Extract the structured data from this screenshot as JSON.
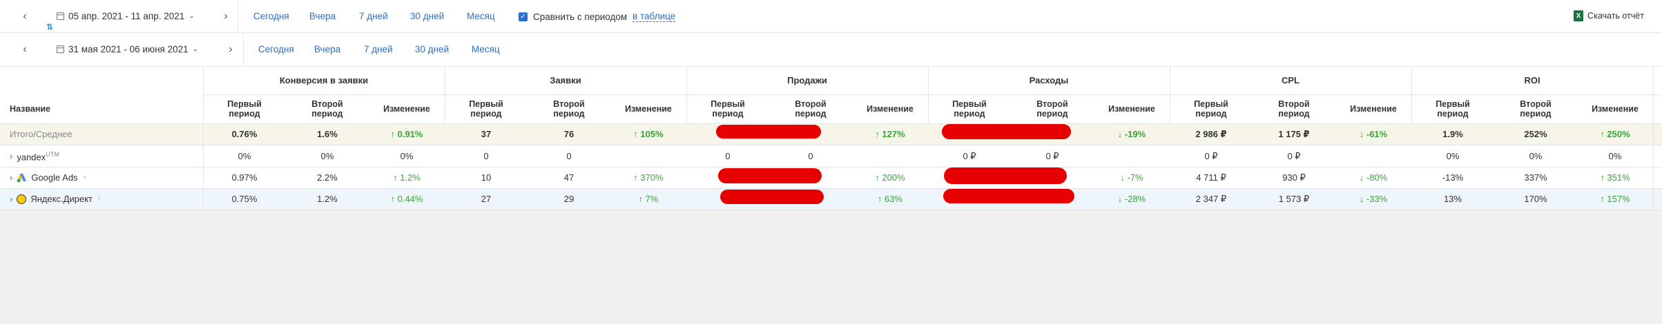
{
  "toolbar1": {
    "date_range": "05 апр. 2021 - 11 апр. 2021",
    "quick": [
      "Сегодня",
      "Вчера",
      "7 дней",
      "30 дней",
      "Месяц"
    ],
    "compare_label": "Сравнить с периодом",
    "compare_link": "в таблице",
    "compare_checked": true,
    "download": "Скачать отчёт"
  },
  "toolbar2": {
    "date_range": "31 мая 2021 - 06 июня 2021",
    "quick": [
      "Сегодня",
      "Вчера",
      "7 дней",
      "30 дней",
      "Месяц"
    ]
  },
  "table": {
    "name_header": "Название",
    "groups": [
      "Конверсия в заявки",
      "Заявки",
      "Продажи",
      "Расходы",
      "CPL",
      "ROI"
    ],
    "sub_headers": [
      "Первый период",
      "Второй период",
      "Изменение"
    ],
    "rows": [
      {
        "name": "Итого/Среднее",
        "kind": "total",
        "values": [
          "0.76%",
          "1.6%",
          "↑ 0.91%",
          "37",
          "76",
          "↑ 105%",
          "",
          "",
          "↑ 127%",
          "",
          "",
          "↓ -19%",
          "2 986 ₽",
          "1 175 ₽",
          "↓ -61%",
          "1.9%",
          "252%",
          "↑ 250%"
        ]
      },
      {
        "name": "yandex",
        "sup": "UTM",
        "kind": "plain",
        "values": [
          "0%",
          "0%",
          "0%",
          "0",
          "0",
          "",
          "0",
          "0",
          "",
          "0 ₽",
          "0 ₽",
          "",
          "0 ₽",
          "0 ₽",
          "",
          "0%",
          "0%",
          "0%"
        ]
      },
      {
        "name": "Google Ads",
        "kind": "gads",
        "values": [
          "0.97%",
          "2.2%",
          "↑ 1.2%",
          "10",
          "47",
          "↑ 370%",
          "",
          "",
          "↑ 200%",
          "",
          "",
          "↓ -7%",
          "4 711 ₽",
          "930 ₽",
          "↓ -80%",
          "-13%",
          "337%",
          "↑ 351%"
        ]
      },
      {
        "name": "Яндекс.Директ",
        "kind": "ydirect",
        "values": [
          "0.75%",
          "1.2%",
          "↑ 0.44%",
          "27",
          "29",
          "↑ 7%",
          "",
          "",
          "↑ 63%",
          "",
          "",
          "↓ -28%",
          "2 347 ₽",
          "1 573 ₽",
          "↓ -33%",
          "13%",
          "170%",
          "↑ 157%"
        ]
      }
    ]
  }
}
